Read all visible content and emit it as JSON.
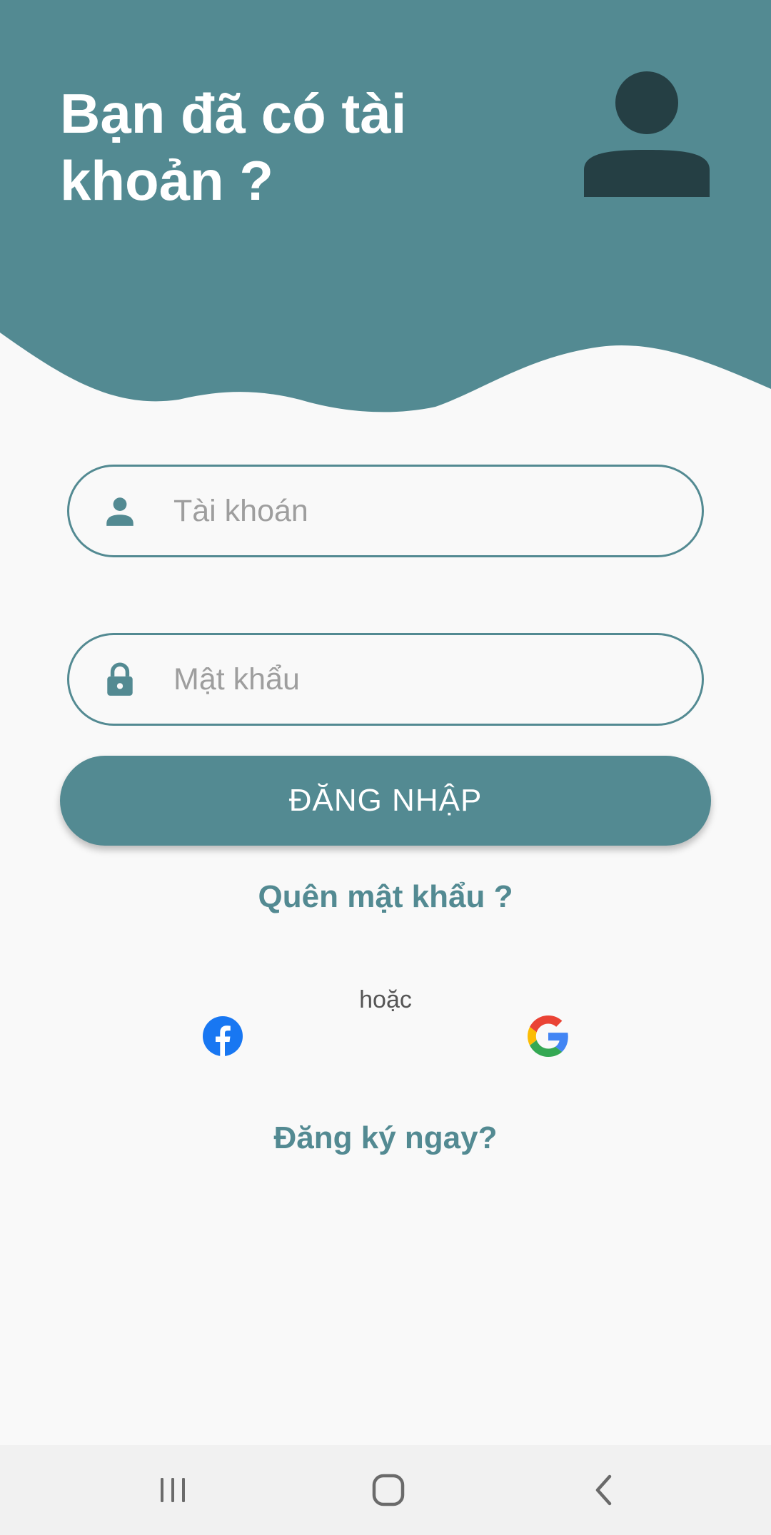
{
  "header": {
    "title": "Bạn đã có tài\nkhoản ?",
    "color": "#538a92",
    "avatar_icon": "person-icon"
  },
  "form": {
    "username": {
      "placeholder": "Tài khoán",
      "value": "",
      "icon": "user-icon"
    },
    "password": {
      "placeholder": "Mật khẩu",
      "value": "",
      "icon": "lock-icon"
    },
    "login_label": "ĐĂNG NHẬP",
    "forgot_label": "Quên mật khẩu ?"
  },
  "social": {
    "or_label": "hoặc",
    "providers": [
      "facebook-icon",
      "google-icon"
    ]
  },
  "register_label": "Đăng ký ngay?",
  "navbar": {
    "buttons": [
      "recent-apps-icon",
      "home-icon",
      "back-icon"
    ]
  }
}
